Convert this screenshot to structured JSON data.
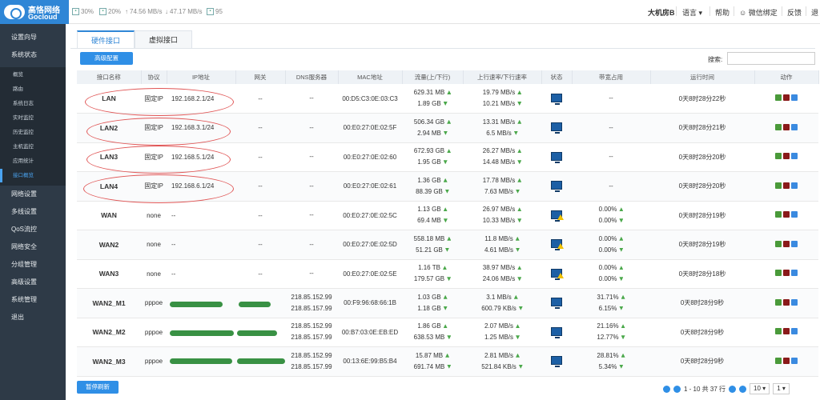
{
  "header": {
    "logo": {
      "line1": "高恪网络",
      "line2": "Gocloud"
    },
    "stats": [
      {
        "icon": "cpu-icon",
        "text": "30%"
      },
      {
        "icon": "memory-icon",
        "text": "20%"
      },
      {
        "icon": "upload-icon",
        "text": "74.56 MB/s"
      },
      {
        "icon": "download-icon",
        "text": "47.17 MB/s"
      },
      {
        "icon": "connections-icon",
        "text": "95"
      }
    ],
    "nav": {
      "device": "大机房B",
      "language": "语言",
      "help": "帮助",
      "wechat": "微信绑定",
      "feedback": "反馈",
      "logout": "退"
    }
  },
  "sidebar": {
    "items": [
      {
        "label": "设置向导"
      },
      {
        "label": "系统状态"
      }
    ],
    "sub_items": [
      {
        "label": "概览"
      },
      {
        "label": "路由"
      },
      {
        "label": "系统日志"
      },
      {
        "label": "实时监控"
      },
      {
        "label": "历史监控"
      },
      {
        "label": "主机监控"
      },
      {
        "label": "应用统计"
      },
      {
        "label": "接口概览"
      }
    ],
    "items_after": [
      {
        "label": "网络设置"
      },
      {
        "label": "多线设置"
      },
      {
        "label": "QoS流控"
      },
      {
        "label": "网络安全"
      },
      {
        "label": "分组管理"
      },
      {
        "label": "高级设置"
      },
      {
        "label": "系统管理"
      },
      {
        "label": "退出"
      }
    ]
  },
  "tabs": {
    "hardware": "硬件接口",
    "virtual": "虚拟接口"
  },
  "toolbar": {
    "advanced_button": "高级配置",
    "search_label": "搜索:",
    "pause_button": "暂停刷新"
  },
  "table": {
    "headers": [
      "接口名称",
      "协议",
      "IP地址",
      "网关",
      "DNS服务器",
      "MAC地址",
      "流量(上/下行)",
      "上行速率/下行速率",
      "状态",
      "带宽占用",
      "运行时间",
      "动作"
    ],
    "rows": [
      {
        "name": "LAN",
        "proto": "固定IP",
        "ip": "192.168.2.1/24",
        "gw": "--",
        "dns": [
          "--"
        ],
        "mac": "00:D5:C3:0E:03:C3",
        "traffic": [
          "629.31 MB",
          "1.89 GB"
        ],
        "rate": [
          "19.79 MB/s",
          "10.21 MB/s"
        ],
        "status": "ok",
        "bw": [
          "--"
        ],
        "uptime": "0天8时28分22秒"
      },
      {
        "name": "LAN2",
        "proto": "固定IP",
        "ip": "192.168.3.1/24",
        "gw": "--",
        "dns": [
          "--"
        ],
        "mac": "00:E0:27:0E:02:5F",
        "traffic": [
          "506.34 GB",
          "2.94 MB"
        ],
        "rate": [
          "13.31 MB/s",
          "6.5 MB/s"
        ],
        "status": "ok",
        "bw": [
          "--"
        ],
        "uptime": "0天8时28分21秒"
      },
      {
        "name": "LAN3",
        "proto": "固定IP",
        "ip": "192.168.5.1/24",
        "gw": "--",
        "dns": [
          "--"
        ],
        "mac": "00:E0:27:0E:02:60",
        "traffic": [
          "672.93 GB",
          "1.95 GB"
        ],
        "rate": [
          "26.27 MB/s",
          "14.48 MB/s"
        ],
        "status": "ok",
        "bw": [
          "--"
        ],
        "uptime": "0天8时28分20秒"
      },
      {
        "name": "LAN4",
        "proto": "固定IP",
        "ip": "192.168.6.1/24",
        "gw": "--",
        "dns": [
          "--"
        ],
        "mac": "00:E0:27:0E:02:61",
        "traffic": [
          "1.36 GB",
          "88.39 GB"
        ],
        "rate": [
          "17.78 MB/s",
          "7.63 MB/s"
        ],
        "status": "ok",
        "bw": [
          "--"
        ],
        "uptime": "0天8时28分20秒"
      },
      {
        "name": "WAN",
        "proto": "none",
        "ip": "--",
        "gw": "--",
        "dns": [
          "--"
        ],
        "mac": "00:E0:27:0E:02:5C",
        "traffic": [
          "1.13 GB",
          "69.4 MB"
        ],
        "rate": [
          "26.97 MB/s",
          "10.33 MB/s"
        ],
        "status": "warn",
        "bw": [
          "0.00%",
          "0.00%"
        ],
        "uptime": "0天8时28分19秒"
      },
      {
        "name": "WAN2",
        "proto": "none",
        "ip": "--",
        "gw": "--",
        "dns": [
          "--"
        ],
        "mac": "00:E0:27:0E:02:5D",
        "traffic": [
          "558.18 MB",
          "51.21 GB"
        ],
        "rate": [
          "11.8 MB/s",
          "4.61 MB/s"
        ],
        "status": "warn",
        "bw": [
          "0.00%",
          "0.00%"
        ],
        "uptime": "0天8时28分19秒"
      },
      {
        "name": "WAN3",
        "proto": "none",
        "ip": "--",
        "gw": "--",
        "dns": [
          "--"
        ],
        "mac": "00:E0:27:0E:02:5E",
        "traffic": [
          "1.16 TB",
          "179.57 GB"
        ],
        "rate": [
          "38.97 MB/s",
          "24.06 MB/s"
        ],
        "status": "warn",
        "bw": [
          "0.00%",
          "0.00%"
        ],
        "uptime": "0天8时28分18秒"
      },
      {
        "name": "WAN2_M1",
        "proto": "pppoe",
        "ip": "",
        "gw": "",
        "dns": [
          "218.85.152.99",
          "218.85.157.99"
        ],
        "mac": "00:F9:96:68:66:1B",
        "traffic": [
          "1.03 GB",
          "1.18 GB"
        ],
        "rate": [
          "3.1 MB/s",
          "600.79 KB/s"
        ],
        "status": "ok",
        "bw": [
          "31.71%",
          "6.15%"
        ],
        "uptime": "0天8时28分9秒"
      },
      {
        "name": "WAN2_M2",
        "proto": "pppoe",
        "ip": "",
        "gw": "",
        "dns": [
          "218.85.152.99",
          "218.85.157.99"
        ],
        "mac": "00:B7:03:0E:EB:ED",
        "traffic": [
          "1.86 GB",
          "638.53 MB"
        ],
        "rate": [
          "2.07 MB/s",
          "1.25 MB/s"
        ],
        "status": "ok",
        "bw": [
          "21.16%",
          "12.77%"
        ],
        "uptime": "0天8时28分9秒"
      },
      {
        "name": "WAN2_M3",
        "proto": "pppoe",
        "ip": "",
        "gw": "",
        "dns": [
          "218.85.152.99",
          "218.85.157.99"
        ],
        "mac": "00:13:6E:99:B5:B4",
        "traffic": [
          "15.87 MB",
          "691.74 MB"
        ],
        "rate": [
          "2.81 MB/s",
          "521.84 KB/s"
        ],
        "status": "ok",
        "bw": [
          "28.81%",
          "5.34%"
        ],
        "uptime": "0天8时28分9秒"
      }
    ]
  },
  "pager": {
    "info": "1 - 10 共 37 行",
    "page_size": "10",
    "page": "1"
  },
  "colors": {
    "accent": "#2f8fe6",
    "sidebar": "#2e3a47",
    "ok": "#4aa84a"
  }
}
